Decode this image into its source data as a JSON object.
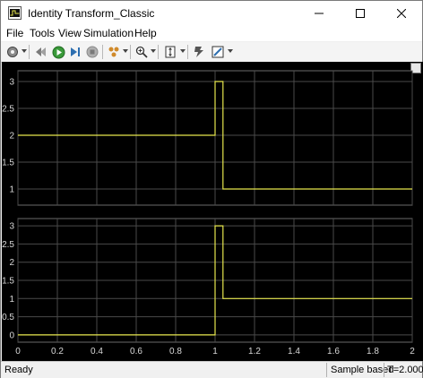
{
  "window": {
    "title": "Identity Transform_Classic"
  },
  "menu": [
    "File",
    "Tools",
    "View",
    "Simulation",
    "Help"
  ],
  "toolbar_icons": [
    "settings-icon",
    "restore-layout-icon",
    "run-icon",
    "step-forward-icon",
    "stop-icon",
    "highlight-icon",
    "zoom-icon",
    "autoscale-icon",
    "triggers-icon",
    "style-icon"
  ],
  "status": {
    "left": "Ready",
    "mode": "Sample based",
    "time": "T=2.000"
  },
  "colors": {
    "signal": "#e6e64c",
    "axes_bg": "#000000",
    "grid": "#4a4a4a",
    "tick_text": "#d8d8d8"
  },
  "chart_data": [
    {
      "type": "line",
      "title": "",
      "xlabel": "",
      "ylabel": "",
      "xlim": [
        0,
        2
      ],
      "ylim": [
        0.7,
        3.2
      ],
      "xticks": [
        0,
        0.2,
        0.4,
        0.6,
        0.8,
        1,
        1.2,
        1.4,
        1.6,
        1.8,
        2
      ],
      "yticks": [
        1,
        1.5,
        2,
        2.5,
        3
      ],
      "ytick_labels": [
        "1",
        "1.5",
        "2",
        "2.5",
        "3"
      ],
      "grid": true,
      "series": [
        {
          "x": [
            0,
            1.0,
            1.0,
            1.04,
            1.04,
            2.0
          ],
          "y": [
            2,
            2,
            3,
            3,
            1,
            1
          ]
        }
      ]
    },
    {
      "type": "line",
      "title": "",
      "xlabel": "",
      "ylabel": "",
      "xlim": [
        0,
        2
      ],
      "ylim": [
        -0.2,
        3.2
      ],
      "xticks": [
        0,
        0.2,
        0.4,
        0.6,
        0.8,
        1,
        1.2,
        1.4,
        1.6,
        1.8,
        2
      ],
      "xtick_labels": [
        "0",
        "0.2",
        "0.4",
        "0.6",
        "0.8",
        "1",
        "1.2",
        "1.4",
        "1.6",
        "1.8",
        "2"
      ],
      "yticks": [
        0,
        0.5,
        1,
        1.5,
        2,
        2.5,
        3
      ],
      "ytick_labels": [
        "0",
        "0.5",
        "1",
        "1.5",
        "2",
        "2.5",
        "3"
      ],
      "grid": true,
      "series": [
        {
          "x": [
            0,
            1.0,
            1.0,
            1.04,
            1.04,
            2.0
          ],
          "y": [
            0,
            0,
            3,
            3,
            1,
            1
          ]
        }
      ]
    }
  ]
}
